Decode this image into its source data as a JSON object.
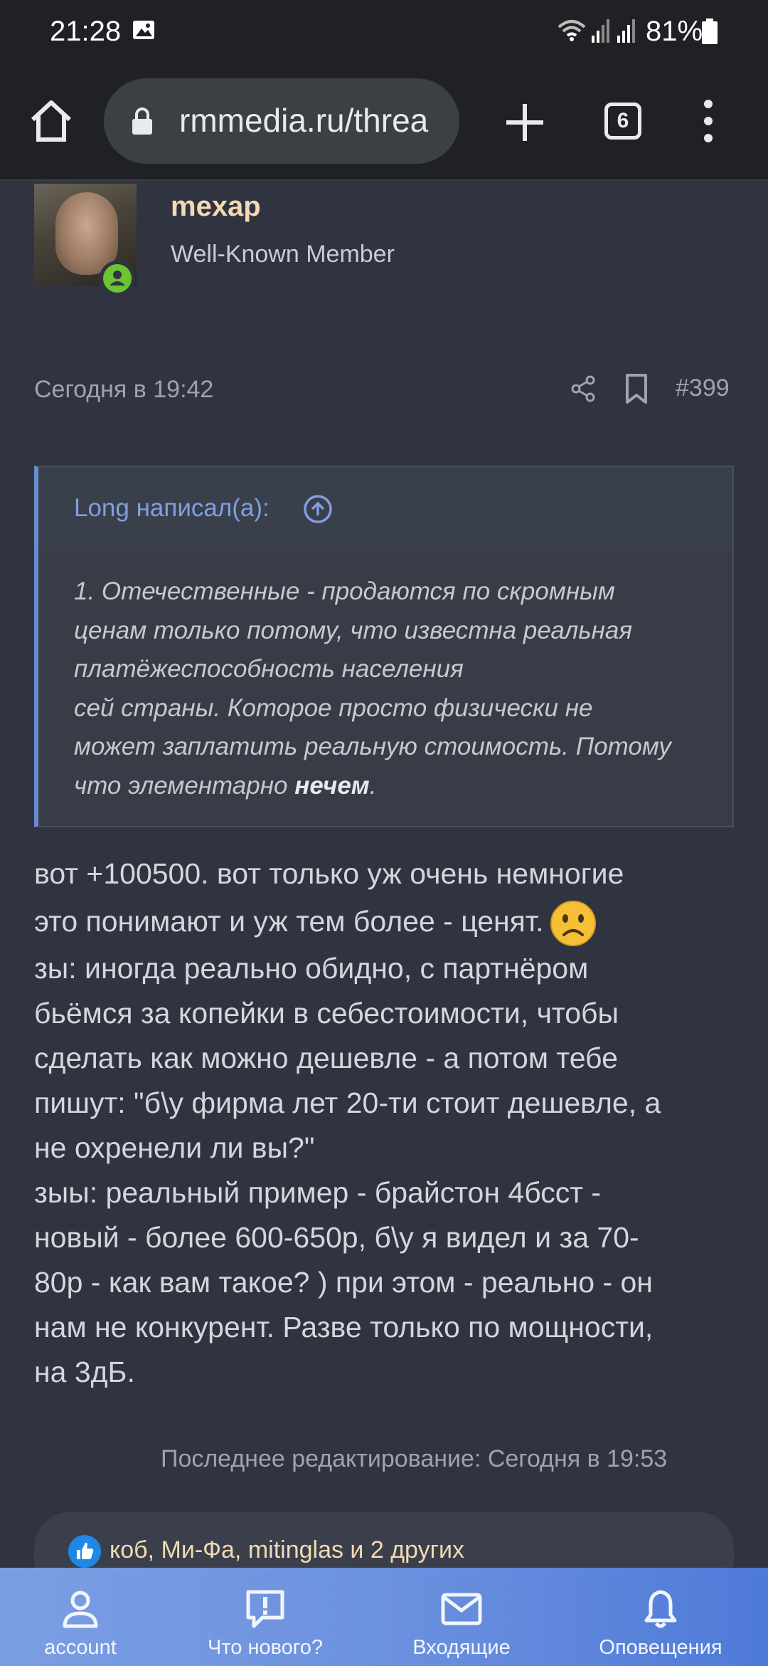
{
  "status_bar": {
    "time": "21:28",
    "battery": "81%",
    "icons": [
      "gallery-icon",
      "wifi-icon",
      "signal-icon",
      "signal-icon",
      "battery-icon"
    ]
  },
  "browser": {
    "url": "rmmedia.ru/threa",
    "tab_count": "6",
    "icons": [
      "home-icon",
      "lock-icon",
      "plus-icon",
      "tabs-icon",
      "more-vert-icon"
    ]
  },
  "post": {
    "username": "mexap",
    "user_title": "Well-Known Member",
    "date": "Сегодня в 19:42",
    "number": "#399",
    "quote": {
      "author": "Long написал(а):",
      "lines": [
        "1. Отечественные - продаются по скромным",
        "ценам только потому, что известна реальная",
        "платёжеспособность населения",
        "сей страны. Которое просто физически не",
        "может заплатить реальную стоимость. Потому"
      ],
      "last_line_prefix": "что элементарно ",
      "last_line_bold": "нечем",
      "last_line_suffix": "."
    },
    "body_lines": [
      "вот +100500. вот только уж очень немногие",
      "это понимают и уж тем более - ценят.",
      "зы: иногда реально обидно, с партнёром",
      "бьёмся за копейки в себестоимости, чтобы",
      "сделать как можно дешевле - а потом тебе",
      "пишут: \"б\\у фирма лет 20-ти стоит дешевле, а",
      "не охренели ли вы?\"",
      "зыы: реальный пример - брайстон 4бсст -",
      "новый - более 600-650р, б\\у я видел и за 70-",
      "80р - как вам такое? ) при этом - реально - он",
      "нам не конкурент. Разве только по мощности,",
      "на 3дБ."
    ],
    "last_edit": "Последнее редактирование: Сегодня в 19:53",
    "reactions": "коб, Ми-Фа, mitinglas и 2 других"
  },
  "bottom_nav": {
    "items": [
      {
        "label": "account",
        "icon": "user-icon"
      },
      {
        "label": "Что нового?",
        "icon": "news-icon"
      },
      {
        "label": "Входящие",
        "icon": "mail-icon"
      },
      {
        "label": "Оповещения",
        "icon": "bell-icon"
      }
    ]
  },
  "colors": {
    "background": "#2f3440",
    "accent": "#6a8bd1",
    "username": "#f3d9b4",
    "online": "#6cc430",
    "nav_gradient_start": "#7b9ee3",
    "nav_gradient_end": "#4e7ad8"
  }
}
